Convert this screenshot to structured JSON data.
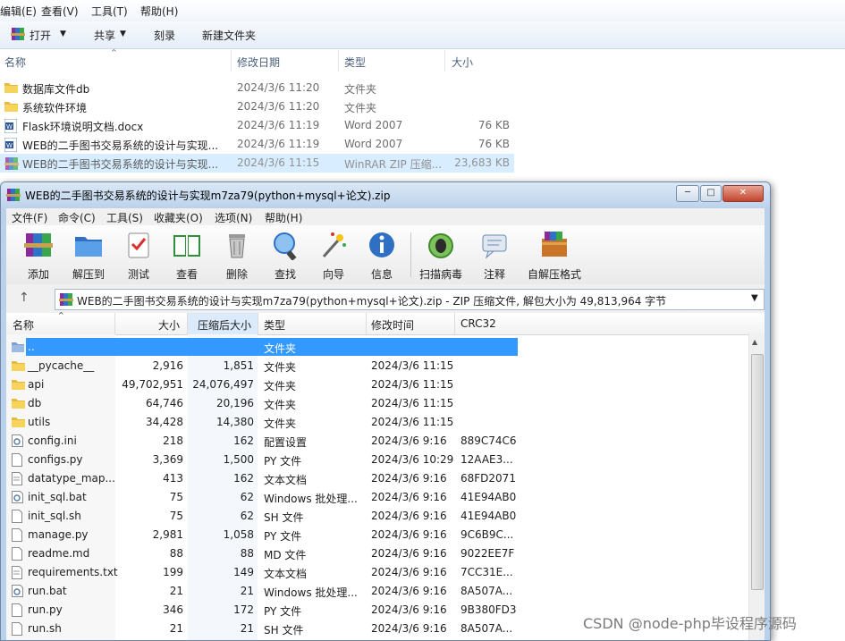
{
  "explorer": {
    "menubar": [
      "编辑(E)",
      "查看(V)",
      "工具(T)",
      "帮助(H)"
    ],
    "toolbar": {
      "open": "打开",
      "share": "共享",
      "burn": "刻录",
      "new_folder": "新建文件夹"
    },
    "columns": [
      "名称",
      "修改日期",
      "类型",
      "大小"
    ],
    "rows": [
      {
        "name": "数据库文件db",
        "date": "2024/3/6 11:20",
        "type": "文件夹",
        "size": "",
        "icon": "folder-icon"
      },
      {
        "name": "系统软件环境",
        "date": "2024/3/6 11:20",
        "type": "文件夹",
        "size": "",
        "icon": "folder-icon"
      },
      {
        "name": "Flask环境说明文档.docx",
        "date": "2024/3/6 11:19",
        "type": "Word 2007",
        "size": "76 KB",
        "icon": "word-doc-icon"
      },
      {
        "name": "WEB的二手图书交易系统的设计与实现...",
        "date": "2024/3/6 11:19",
        "type": "Word 2007",
        "size": "76 KB",
        "icon": "word-doc-icon"
      },
      {
        "name": "WEB的二手图书交易系统的设计与实现...",
        "date": "2024/3/6 11:15",
        "type": "WinRAR ZIP 压缩...",
        "size": "23,683 KB",
        "icon": "winrar-archive-icon"
      }
    ]
  },
  "rar": {
    "title": "WEB的二手图书交易系统的设计与实现m7za79(python+mysql+论文).zip",
    "window_buttons": {
      "minimize": "─",
      "maximize": "□",
      "close": "✕"
    },
    "menubar": [
      "文件(F)",
      "命令(C)",
      "工具(S)",
      "收藏夹(O)",
      "选项(N)",
      "帮助(H)"
    ],
    "toolbar": [
      "添加",
      "解压到",
      "测试",
      "查看",
      "删除",
      "查找",
      "向导",
      "信息",
      "扫描病毒",
      "注释",
      "自解压格式"
    ],
    "address": "WEB的二手图书交易系统的设计与实现m7za79(python+mysql+论文).zip - ZIP 压缩文件, 解包大小为 49,813,964 字节",
    "columns": [
      "名称",
      "大小",
      "压缩后大小",
      "类型",
      "修改时间",
      "CRC32"
    ],
    "rows": [
      {
        "name": "..",
        "size": "",
        "packed": "",
        "type": "文件夹",
        "mtime": "",
        "crc": "",
        "icon": "up-folder-icon"
      },
      {
        "name": "__pycache__",
        "size": "2,916",
        "packed": "1,851",
        "type": "文件夹",
        "mtime": "2024/3/6 11:15",
        "crc": "",
        "icon": "folder-icon"
      },
      {
        "name": "api",
        "size": "49,702,951",
        "packed": "24,076,497",
        "type": "文件夹",
        "mtime": "2024/3/6 11:15",
        "crc": "",
        "icon": "folder-icon"
      },
      {
        "name": "db",
        "size": "64,746",
        "packed": "20,196",
        "type": "文件夹",
        "mtime": "2024/3/6 11:15",
        "crc": "",
        "icon": "folder-icon"
      },
      {
        "name": "utils",
        "size": "34,428",
        "packed": "14,380",
        "type": "文件夹",
        "mtime": "2024/3/6 11:15",
        "crc": "",
        "icon": "folder-icon"
      },
      {
        "name": "config.ini",
        "size": "218",
        "packed": "162",
        "type": "配置设置",
        "mtime": "2024/3/6 9:16",
        "crc": "889C74C6",
        "icon": "settings-file-icon"
      },
      {
        "name": "configs.py",
        "size": "3,369",
        "packed": "1,500",
        "type": "PY 文件",
        "mtime": "2024/3/6 10:29",
        "crc": "12AAE3...",
        "icon": "file-icon"
      },
      {
        "name": "datatype_map...",
        "size": "413",
        "packed": "162",
        "type": "文本文档",
        "mtime": "2024/3/6 9:16",
        "crc": "68FD2071",
        "icon": "text-file-icon"
      },
      {
        "name": "init_sql.bat",
        "size": "75",
        "packed": "62",
        "type": "Windows 批处理...",
        "mtime": "2024/3/6 9:16",
        "crc": "41E94AB0",
        "icon": "batch-file-icon"
      },
      {
        "name": "init_sql.sh",
        "size": "75",
        "packed": "62",
        "type": "SH 文件",
        "mtime": "2024/3/6 9:16",
        "crc": "41E94AB0",
        "icon": "file-icon"
      },
      {
        "name": "manage.py",
        "size": "2,981",
        "packed": "1,058",
        "type": "PY 文件",
        "mtime": "2024/3/6 9:16",
        "crc": "9C6B9C...",
        "icon": "file-icon"
      },
      {
        "name": "readme.md",
        "size": "88",
        "packed": "88",
        "type": "MD 文件",
        "mtime": "2024/3/6 9:16",
        "crc": "9022EE7F",
        "icon": "file-icon"
      },
      {
        "name": "requirements.txt",
        "size": "199",
        "packed": "149",
        "type": "文本文档",
        "mtime": "2024/3/6 9:16",
        "crc": "7CC31E...",
        "icon": "text-file-icon"
      },
      {
        "name": "run.bat",
        "size": "21",
        "packed": "21",
        "type": "Windows 批处理...",
        "mtime": "2024/3/6 9:16",
        "crc": "8A507A...",
        "icon": "batch-file-icon"
      },
      {
        "name": "run.py",
        "size": "346",
        "packed": "172",
        "type": "PY 文件",
        "mtime": "2024/3/6 9:16",
        "crc": "9B380FD3",
        "icon": "file-icon"
      },
      {
        "name": "run.sh",
        "size": "21",
        "packed": "21",
        "type": "SH 文件",
        "mtime": "2024/3/6 9:16",
        "crc": "8A507A...",
        "icon": "file-icon"
      }
    ]
  },
  "watermark": "CSDN @node-php毕设程序源码",
  "colors": {
    "selection": "#cce8ff",
    "rar_selection": "#3399ff",
    "title_bar": "#bdd3ec"
  }
}
